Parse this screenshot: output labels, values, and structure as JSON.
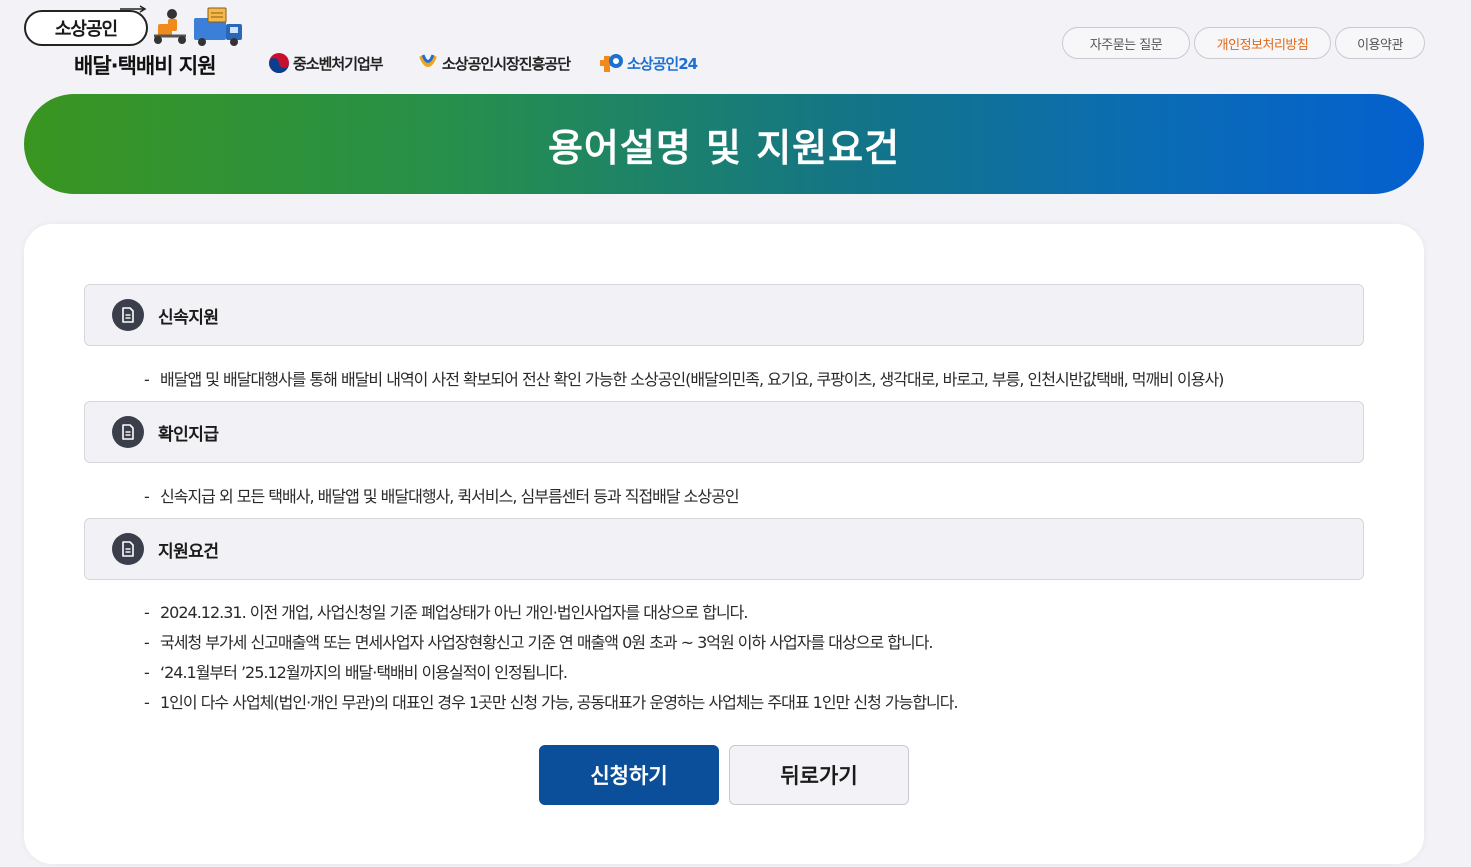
{
  "header": {
    "logo_main": "소상공인",
    "logo_sub": "배달·택배비 지원",
    "orgs": [
      "중소벤처기업부",
      "소상공인시장진흥공단",
      "소상공인24"
    ],
    "links": {
      "faq": "자주묻는 질문",
      "privacy": "개인정보처리방침",
      "terms": "이용약관"
    }
  },
  "banner": {
    "title": "용어설명 및 지원요건"
  },
  "sections": [
    {
      "title": "신속지원",
      "items": [
        "배달앱 및 배달대행사를 통해 배달비 내역이 사전 확보되어 전산 확인 가능한 소상공인(배달의민족, 요기요, 쿠팡이츠, 생각대로, 바로고, 부릉, 인천시반값택배, 먹깨비 이용사)"
      ]
    },
    {
      "title": "확인지급",
      "items": [
        "신속지급 외 모든 택배사, 배달앱 및 배달대행사, 퀵서비스, 심부름센터 등과 직접배달 소상공인"
      ]
    },
    {
      "title": "지원요건",
      "items": [
        "2024.12.31. 이전 개업, 사업신청일 기준 폐업상태가 아닌 개인·법인사업자를 대상으로 합니다.",
        "국세청 부가세 신고매출액 또는 면세사업자 사업장현황신고 기준 연 매출액 0원 초과 ~ 3억원 이하 사업자를 대상으로 합니다.",
        "‘24.1월부터 ’25.12월까지의 배달·택배비 이용실적이 인정됩니다.",
        "1인이 다수 사업체(법인·개인 무관)의 대표인 경우 1곳만 신청 가능, 공동대표가 운영하는 사업체는 주대표 1인만 신청 가능합니다."
      ]
    }
  ],
  "buttons": {
    "apply": "신청하기",
    "back": "뒤로가기"
  },
  "colors": {
    "primary": "#0b4f9a",
    "banner_start": "#3a9520",
    "banner_end": "#0460cf",
    "privacy_link": "#e0691a"
  }
}
